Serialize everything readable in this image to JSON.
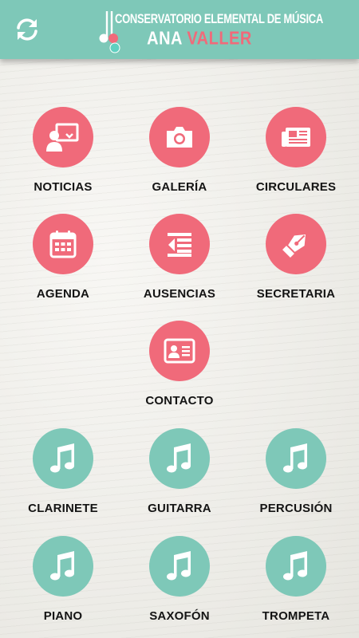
{
  "header": {
    "logo_line1": "CONSERVATORIO ELEMENTAL DE MÚSICA",
    "logo_name_first": "ANA",
    "logo_name_second": "VALLER",
    "refresh_icon": "refresh-icon",
    "bg_color": "#7ec8b8",
    "accent_color": "#f06a7a"
  },
  "menu": {
    "noticias": {
      "label": "NOTICIAS",
      "icon": "presentation-user-icon"
    },
    "galeria": {
      "label": "GALERÍA",
      "icon": "camera-icon"
    },
    "circulares": {
      "label": "CIRCULARES",
      "icon": "newspaper-icon"
    },
    "agenda": {
      "label": "AGENDA",
      "icon": "calendar-icon"
    },
    "ausencias": {
      "label": "AUSENCIAS",
      "icon": "outdent-icon"
    },
    "secretaria": {
      "label": "SECRETARIA",
      "icon": "fountain-pen-icon"
    },
    "contacto": {
      "label": "CONTACTO",
      "icon": "contact-card-icon"
    }
  },
  "instruments": {
    "clarinete": {
      "label": "CLARINETE",
      "icon": "music-note-icon"
    },
    "guitarra": {
      "label": "GUITARRA",
      "icon": "music-note-icon"
    },
    "percusion": {
      "label": "PERCUSIÓN",
      "icon": "music-note-icon"
    },
    "piano": {
      "label": "PIANO",
      "icon": "music-note-icon"
    },
    "saxofon": {
      "label": "SAXOFÓN",
      "icon": "music-note-icon"
    },
    "trompeta": {
      "label": "TROMPETA",
      "icon": "music-note-icon"
    }
  },
  "colors": {
    "pink": "#f06a7a",
    "teal": "#7ec8b8",
    "background": "#f1f0ec"
  }
}
